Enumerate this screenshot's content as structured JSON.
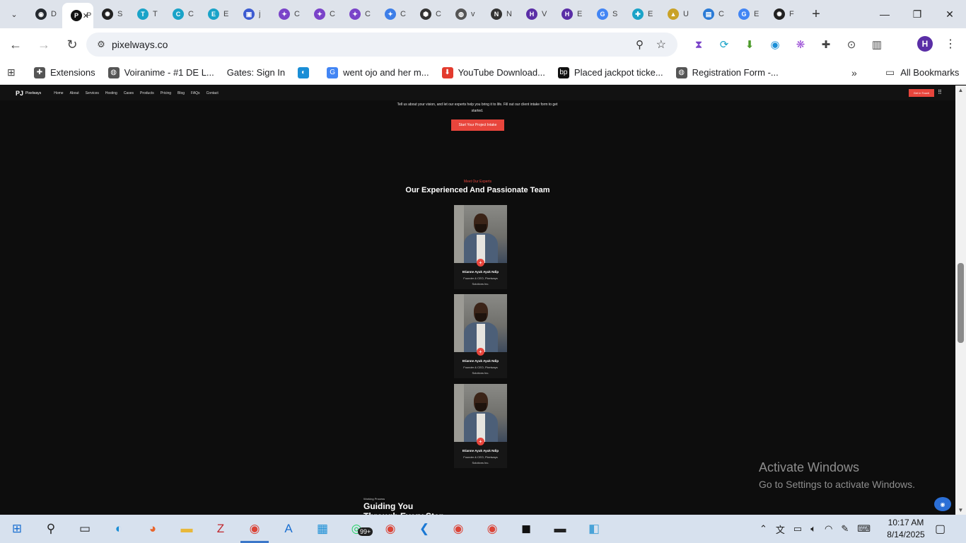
{
  "browser": {
    "tabs": [
      {
        "title": "D",
        "icon": "github-icon",
        "color": "#24292f",
        "glyph": "◉"
      },
      {
        "title": "P",
        "icon": "pixelways-icon",
        "color": "#111111",
        "glyph": "P",
        "active": true
      },
      {
        "title": "S",
        "icon": "openai-icon",
        "color": "#222222",
        "glyph": "✺"
      },
      {
        "title": "T",
        "icon": "t-icon",
        "color": "#1aa3c8",
        "glyph": "T"
      },
      {
        "title": "C",
        "icon": "c-icon",
        "color": "#1aa3c8",
        "glyph": "C"
      },
      {
        "title": "E",
        "icon": "e-icon",
        "color": "#1aa3c8",
        "glyph": "E"
      },
      {
        "title": "j",
        "icon": "printer-icon",
        "color": "#3c5bd1",
        "glyph": "▣"
      },
      {
        "title": "C",
        "icon": "purple-star-icon",
        "color": "#7a43c9",
        "glyph": "✦"
      },
      {
        "title": "C",
        "icon": "purple-star-icon",
        "color": "#7a43c9",
        "glyph": "✦"
      },
      {
        "title": "C",
        "icon": "purple-star-icon",
        "color": "#7a43c9",
        "glyph": "✦"
      },
      {
        "title": "C",
        "icon": "gemini-icon",
        "color": "#3d7ee8",
        "glyph": "✦"
      },
      {
        "title": "C",
        "icon": "hexagon-icon",
        "color": "#333333",
        "glyph": "⬢"
      },
      {
        "title": "v",
        "icon": "globe-icon",
        "color": "#555555",
        "glyph": "◍"
      },
      {
        "title": "N",
        "icon": "n-icon",
        "color": "#333333",
        "glyph": "N"
      },
      {
        "title": "V",
        "icon": "h-icon",
        "color": "#5a2ea6",
        "glyph": "H"
      },
      {
        "title": "E",
        "icon": "h-icon",
        "color": "#5a2ea6",
        "glyph": "H"
      },
      {
        "title": "S",
        "icon": "google-icon",
        "color": "#4285f4",
        "glyph": "G"
      },
      {
        "title": "E",
        "icon": "puzzle-icon",
        "color": "#1aa3c8",
        "glyph": "✚"
      },
      {
        "title": "U",
        "icon": "cap-icon",
        "color": "#c9a227",
        "glyph": "▲"
      },
      {
        "title": "C",
        "icon": "doc-icon",
        "color": "#2b7bd6",
        "glyph": "▤"
      },
      {
        "title": "E",
        "icon": "google-icon",
        "color": "#4285f4",
        "glyph": "G"
      },
      {
        "title": "F",
        "icon": "openai-icon",
        "color": "#222222",
        "glyph": "✺"
      }
    ],
    "url": "pixelways.co",
    "bookmarks": [
      {
        "label": "Extensions",
        "icon": "puzzle-icon",
        "color": "#555555",
        "glyph": "✚"
      },
      {
        "label": "Voiranime - #1 DE L...",
        "icon": "globe-icon",
        "color": "#555555",
        "glyph": "◍"
      },
      {
        "label": "Gates: Sign In",
        "icon": "gates-icon",
        "color": "#ffffff",
        "glyph": ""
      },
      {
        "label": "",
        "icon": "edge-icon",
        "color": "#1a8ed6",
        "glyph": "◐"
      },
      {
        "label": "went ojo and her m...",
        "icon": "google-icon",
        "color": "#4285f4",
        "glyph": "G"
      },
      {
        "label": "YouTube Download...",
        "icon": "download-icon",
        "color": "#e33b2e",
        "glyph": "⬇"
      },
      {
        "label": "Placed jackpot ticke...",
        "icon": "bp-icon",
        "color": "#111111",
        "glyph": "bp"
      },
      {
        "label": "Registration Form -...",
        "icon": "globe-icon",
        "color": "#555555",
        "glyph": "◍"
      }
    ],
    "all_bookmarks": "All Bookmarks",
    "avatar": "H",
    "extensions": [
      {
        "icon": "extension-purple-icon",
        "color": "#7a43c9",
        "glyph": "⧗"
      },
      {
        "icon": "extension-sync-icon",
        "color": "#1aa3c8",
        "glyph": "⟳"
      },
      {
        "icon": "extension-green-icon",
        "color": "#4c9a2a",
        "glyph": "⬇"
      },
      {
        "icon": "extension-blue-icon",
        "color": "#1a8ed6",
        "glyph": "◉"
      },
      {
        "icon": "extension-brain-icon",
        "color": "#9b4fd6",
        "glyph": "❋"
      },
      {
        "icon": "extensions-puzzle-icon",
        "color": "#444444",
        "glyph": "✚"
      },
      {
        "icon": "screenshot-icon",
        "color": "#444444",
        "glyph": "⊙"
      },
      {
        "icon": "reading-mode-icon",
        "color": "#444444",
        "glyph": "▥"
      }
    ]
  },
  "site": {
    "logo": "Pixelways",
    "nav_links": [
      "Home",
      "About",
      "Services",
      "Hosting",
      "Cases",
      "Products",
      "Pricing",
      "Blog",
      "FAQs",
      "Contact"
    ],
    "nav_cta": "Get in Touch",
    "intro_text": "Tell us about your vision, and let our experts help you bring it to life. Fill out our client intake form to get started.",
    "intake_button": "Start Your Project Intake",
    "team_eyebrow": "Meet Our Experts",
    "team_heading": "Our Experienced And Passionate Team",
    "team": [
      {
        "name": "Etianne Ayuk Ayuk Ndip",
        "role": "Founder & CEO, Pixelways Solutions Inc."
      },
      {
        "name": "Etianne Ayuk Ayuk Ndip",
        "role": "Founder & CEO, Pixelways Solutions Inc."
      },
      {
        "name": "Etianne Ayuk Ayuk Ndip",
        "role": "Founder & CEO, Pixelways Solutions Inc."
      }
    ],
    "process_eyebrow": "Working Process",
    "process_heading": "Guiding You Through Every Step of the P..."
  },
  "watermark": {
    "title": "Activate Windows",
    "subtitle": "Go to Settings to activate Windows."
  },
  "taskbar": {
    "apps": [
      {
        "name": "start-icon",
        "glyph": "⊞",
        "color": "#1a6fd1"
      },
      {
        "name": "search-icon",
        "glyph": "⚲",
        "color": "#222222"
      },
      {
        "name": "task-view-icon",
        "glyph": "▭",
        "color": "#222222"
      },
      {
        "name": "edge-icon",
        "glyph": "◐",
        "color": "#1a8ed6"
      },
      {
        "name": "firefox-icon",
        "glyph": "◕",
        "color": "#e8652c"
      },
      {
        "name": "file-explorer-icon",
        "glyph": "▬",
        "color": "#e8b83a"
      },
      {
        "name": "filezilla-icon",
        "glyph": "Z",
        "color": "#c0262c"
      },
      {
        "name": "chrome-profile-icon",
        "glyph": "◉",
        "color": "#db4437",
        "active": true
      },
      {
        "name": "app-store-icon",
        "glyph": "A",
        "color": "#1a6fd1"
      },
      {
        "name": "microsoft-store-icon",
        "glyph": "▦",
        "color": "#1a8ed6"
      },
      {
        "name": "whatsapp-icon",
        "glyph": "◎",
        "color": "#25d366",
        "badge": "99+"
      },
      {
        "name": "chrome-alt-icon",
        "glyph": "◉",
        "color": "#db4437"
      },
      {
        "name": "vscode-icon",
        "glyph": "❮",
        "color": "#1a78d4"
      },
      {
        "name": "chrome-icon",
        "glyph": "◉",
        "color": "#db4437"
      },
      {
        "name": "chrome-icon-2",
        "glyph": "◉",
        "color": "#db4437"
      },
      {
        "name": "capcut-icon",
        "glyph": "◼",
        "color": "#111111"
      },
      {
        "name": "terminal-icon",
        "glyph": "▬",
        "color": "#222222"
      },
      {
        "name": "notes-icon",
        "glyph": "◧",
        "color": "#4aa3d8"
      }
    ],
    "time": "10:17 AM",
    "date": "8/14/2025"
  },
  "colors": {
    "accent": "#e8453c",
    "page_bg": "#0d0d0d",
    "tab_strip": "#dee3eb"
  }
}
